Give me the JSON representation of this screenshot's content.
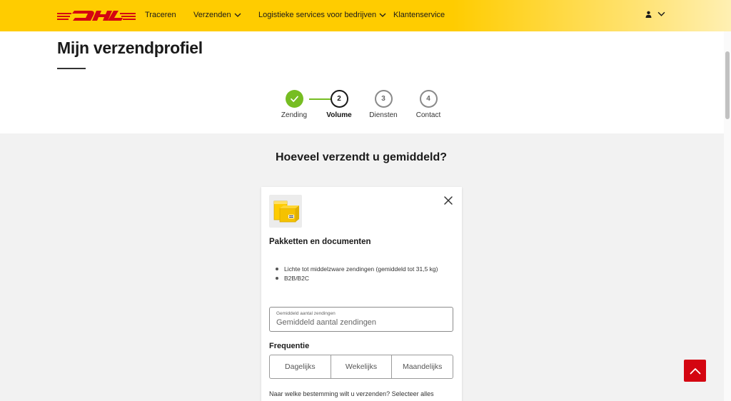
{
  "header": {
    "logo_text": "DHL",
    "nav": [
      {
        "label": "Traceren"
      },
      {
        "label": "Verzenden"
      },
      {
        "label": "Logistieke services voor bedrijven"
      },
      {
        "label": "Klantenservice"
      }
    ],
    "brand_color": "#ffcc00",
    "logo_color": "#d40511"
  },
  "profile": {
    "title": "Mijn verzendprofiel"
  },
  "stepper": {
    "steps": [
      {
        "number": "1",
        "label": "Zending",
        "state": "done"
      },
      {
        "number": "2",
        "label": "Volume",
        "state": "active"
      },
      {
        "number": "3",
        "label": "Diensten",
        "state": "todo"
      },
      {
        "number": "4",
        "label": "Contact",
        "state": "todo"
      }
    ],
    "done_color": "#76bd22"
  },
  "main": {
    "question": "Hoeveel verzendt u gemiddeld?",
    "card": {
      "title": "Pakketten en documenten",
      "bullets": [
        "Lichte tot middelzware zendingen (gemiddeld tot 31,5 kg)",
        "B2B/B2C"
      ],
      "input": {
        "float_label": "Gemiddeld aantal zendingen",
        "placeholder": "Gemiddeld aantal zendingen"
      },
      "frequency_label": "Frequentie",
      "frequency_options": [
        "Dagelijks",
        "Wekelijks",
        "Maandelijks"
      ],
      "destination_text": "Naar welke bestemming wilt u verzenden? Selecteer alles"
    }
  },
  "scroll_top_color": "#d40511"
}
